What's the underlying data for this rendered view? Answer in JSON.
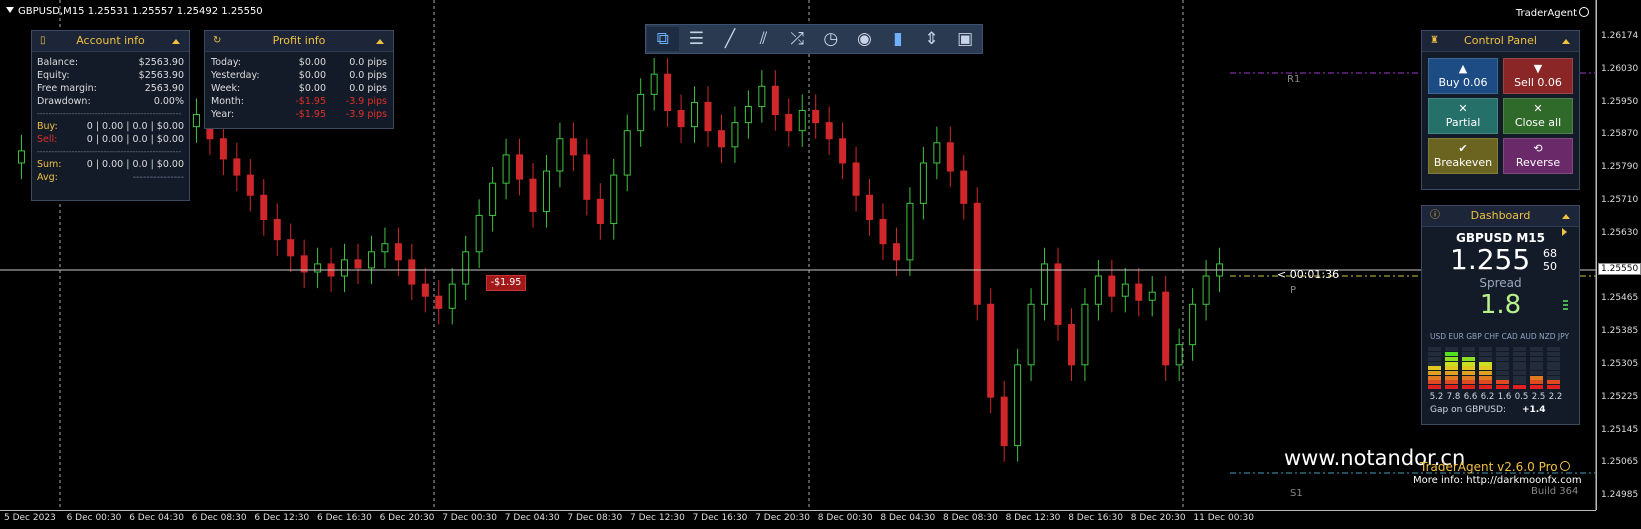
{
  "chart": {
    "symbol_line": "GBPUSD,M15  1.25531 1.25557 1.25492 1.25550",
    "brand": "TraderAgent",
    "current_price": "1.25550",
    "timer": "< 00:01:36",
    "price_labels": [
      "1.26174",
      "1.26030",
      "1.25950",
      "1.25870",
      "1.25790",
      "1.25710",
      "1.25630",
      "1.25550",
      "1.25465",
      "1.25385",
      "1.25305",
      "1.25225",
      "1.25145",
      "1.25065",
      "1.24985"
    ],
    "time_labels": [
      "5 Dec 2023",
      "6 Dec 00:30",
      "6 Dec 04:30",
      "6 Dec 08:30",
      "6 Dec 12:30",
      "6 Dec 16:30",
      "6 Dec 20:30",
      "7 Dec 00:30",
      "7 Dec 04:30",
      "7 Dec 08:30",
      "7 Dec 12:30",
      "7 Dec 16:30",
      "7 Dec 20:30",
      "8 Dec 00:30",
      "8 Dec 04:30",
      "8 Dec 08:30",
      "8 Dec 12:30",
      "8 Dec 16:30",
      "8 Dec 20:30",
      "11 Dec 00:30"
    ],
    "level_labels": {
      "r1": "R1",
      "p": "P",
      "s1": "S1"
    },
    "trade_tag": "-$1.95",
    "candle_closes": [
      1.258,
      1.2583,
      1.2578,
      1.2585,
      1.2591,
      1.2587,
      1.2582,
      1.2588,
      1.2594,
      1.259,
      1.2585,
      1.258,
      1.2584,
      1.2589,
      1.2592,
      1.2586,
      1.2581,
      1.2577,
      1.2572,
      1.2566,
      1.2561,
      1.2557,
      1.2553,
      1.2555,
      1.2552,
      1.2556,
      1.2554,
      1.2558,
      1.256,
      1.2556,
      1.255,
      1.2547,
      1.2544,
      1.255,
      1.2558,
      1.2567,
      1.2575,
      1.2582,
      1.2576,
      1.2568,
      1.2578,
      1.2586,
      1.2582,
      1.2571,
      1.2565,
      1.2577,
      1.2588,
      1.2597,
      1.2602,
      1.2593,
      1.2589,
      1.2595,
      1.2588,
      1.2584,
      1.259,
      1.2594,
      1.2599,
      1.2592,
      1.2588,
      1.2593,
      1.259,
      1.2586,
      1.258,
      1.2572,
      1.2566,
      1.256,
      1.2556,
      1.257,
      1.258,
      1.2585,
      1.2578,
      1.257,
      1.2545,
      1.2522,
      1.251,
      1.253,
      1.2545,
      1.2555,
      1.254,
      1.253,
      1.2545,
      1.2552,
      1.2547,
      1.255,
      1.2546,
      1.2548,
      1.253,
      1.2535,
      1.2545,
      1.2552,
      1.2555
    ],
    "axis_ranges": {
      "y": [
        1.24985,
        1.26174
      ]
    }
  },
  "toolbar": {
    "icons": [
      "windows-icon",
      "menu-icon",
      "line-tool-icon",
      "channel-tool-icon",
      "shuffle-icon",
      "clock-icon",
      "eye-icon",
      "trash-icon",
      "split-icon",
      "camera-icon"
    ]
  },
  "account_info": {
    "title": "Account info",
    "rows": [
      {
        "label": "Balance:",
        "value": "$2563.90"
      },
      {
        "label": "Equity:",
        "value": "$2563.90"
      },
      {
        "label": "Free margin:",
        "value": "2563.90"
      },
      {
        "label": "Drawdown:",
        "value": "0.00%"
      }
    ],
    "buy": {
      "label": "Buy:",
      "value": "0 | 0.00 | 0.0 | $0.00"
    },
    "sell": {
      "label": "Sell:",
      "value": "0 | 0.00 | 0.0 | $0.00"
    },
    "sum": {
      "label": "Sum:",
      "value": "0 | 0.00 | 0.0 | $0.00"
    },
    "avg": {
      "label": "Avg:",
      "value": "---------------"
    }
  },
  "profit_info": {
    "title": "Profit info",
    "rows": [
      {
        "label": "Today:",
        "amount": "$0.00",
        "pips": "0.0 pips",
        "negative": false
      },
      {
        "label": "Yesterday:",
        "amount": "$0.00",
        "pips": "0.0 pips",
        "negative": false
      },
      {
        "label": "Week:",
        "amount": "$0.00",
        "pips": "0.0 pips",
        "negative": false
      },
      {
        "label": "Month:",
        "amount": "-$1.95",
        "pips": "-3.9 pips",
        "negative": true
      },
      {
        "label": "Year:",
        "amount": "-$1.95",
        "pips": "-3.9 pips",
        "negative": true
      }
    ]
  },
  "control_panel": {
    "title": "Control Panel",
    "buy_label": "Buy 0.06",
    "sell_label": "Sell 0.06",
    "partial_label": "Partial",
    "close_all_label": "Close all",
    "breakeven_label": "Breakeven",
    "reverse_label": "Reverse"
  },
  "dashboard": {
    "title": "Dashboard",
    "symbol": "GBPUSD M15",
    "price_main": "1.255",
    "price_sup": "68",
    "price_sub": "50",
    "spread_label": "Spread",
    "spread_value": "1.8",
    "currencies": "USD EUR GBP CHF CAD AUD NZD JPY",
    "strength_values": [
      "5.2",
      "7.8",
      "6.6",
      "6.2",
      "1.6",
      "0.5",
      "2.5",
      "2.2"
    ],
    "gap_label": "Gap on GBPUSD:",
    "gap_value": "+1.4"
  },
  "footer": {
    "watermark": "www.notandor.cn",
    "version": "TraderAgent v2.6.0 Pro",
    "more_info": "More info: http://darkmoonfx.com",
    "build": "Build 364"
  }
}
